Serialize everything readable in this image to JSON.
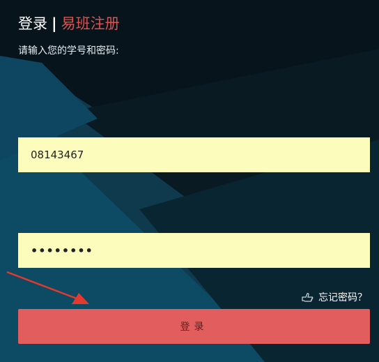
{
  "header": {
    "login_tab": "登录",
    "separator": "|",
    "register_tab": "易班注册"
  },
  "form": {
    "hint": "请输入您的学号和密码:",
    "username_value": "08143467",
    "password_value": "••••••••",
    "forgot_label": "忘记密码？",
    "submit_label": "登录"
  },
  "colors": {
    "register_accent": "#d9534f",
    "input_bg": "#fcfdbd",
    "button_bg": "#e25d5d",
    "annotation_arrow": "#e23a2f"
  },
  "icons": {
    "forgot": "pointing-hand-icon"
  }
}
